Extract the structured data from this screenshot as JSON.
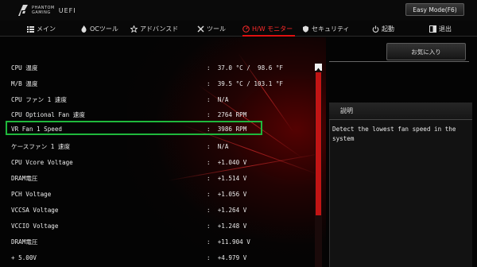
{
  "header": {
    "logo_line1": "PHANTOM",
    "logo_line2": "GAMING",
    "logo_uefi": "UEFI",
    "mode_button": "Easy Mode(F6)"
  },
  "nav": {
    "tabs": [
      {
        "label": "メイン",
        "icon": "list-icon"
      },
      {
        "label": "OCツール",
        "icon": "flame-icon"
      },
      {
        "label": "アドバンスド",
        "icon": "star-icon"
      },
      {
        "label": "ツール",
        "icon": "tools-icon"
      },
      {
        "label": "H/W モニター",
        "icon": "monitor-gauge-icon",
        "active": true
      },
      {
        "label": "セキュリティ",
        "icon": "shield-icon"
      },
      {
        "label": "起動",
        "icon": "power-icon"
      },
      {
        "label": "退出",
        "icon": "exit-icon"
      }
    ]
  },
  "monitor": {
    "rows": [
      {
        "label": "CPU 温度",
        "value": ":  37.0 °C /  98.6 °F"
      },
      {
        "label": "M/B 温度",
        "value": ":  39.5 °C / 103.1 °F"
      },
      {
        "label": "CPU ファン 1 速度",
        "value": ":  N/A"
      },
      {
        "label": "CPU Optional Fan 速度",
        "value": ":  2764 RPM"
      },
      {
        "label": "VR Fan 1 Speed",
        "value": ":  3986 RPM"
      },
      {
        "label": "ケースファン 1 速度",
        "value": ":  N/A"
      },
      {
        "label": "CPU Vcore Voltage",
        "value": ":  +1.040 V"
      },
      {
        "label": "DRAM電圧",
        "value": ":  +1.514 V"
      },
      {
        "label": "PCH Voltage",
        "value": ":  +1.056 V"
      },
      {
        "label": "VCCSA Voltage",
        "value": ":  +1.264 V"
      },
      {
        "label": "VCCIO Voltage",
        "value": ":  +1.248 V"
      },
      {
        "label": "DRAM電圧",
        "value": ":  +11.904 V"
      },
      {
        "label": "+ 5.00V",
        "value": ":  +4.979 V"
      }
    ],
    "selected_label": "VR Fan 1 Speed"
  },
  "side": {
    "favorite_button": "お気に入り",
    "description_title": "説明",
    "description_text": "Detect the lowest fan speed in the system"
  },
  "colors": {
    "accent": "#e01010",
    "selection": "#1fb83c",
    "background": "#050505"
  }
}
